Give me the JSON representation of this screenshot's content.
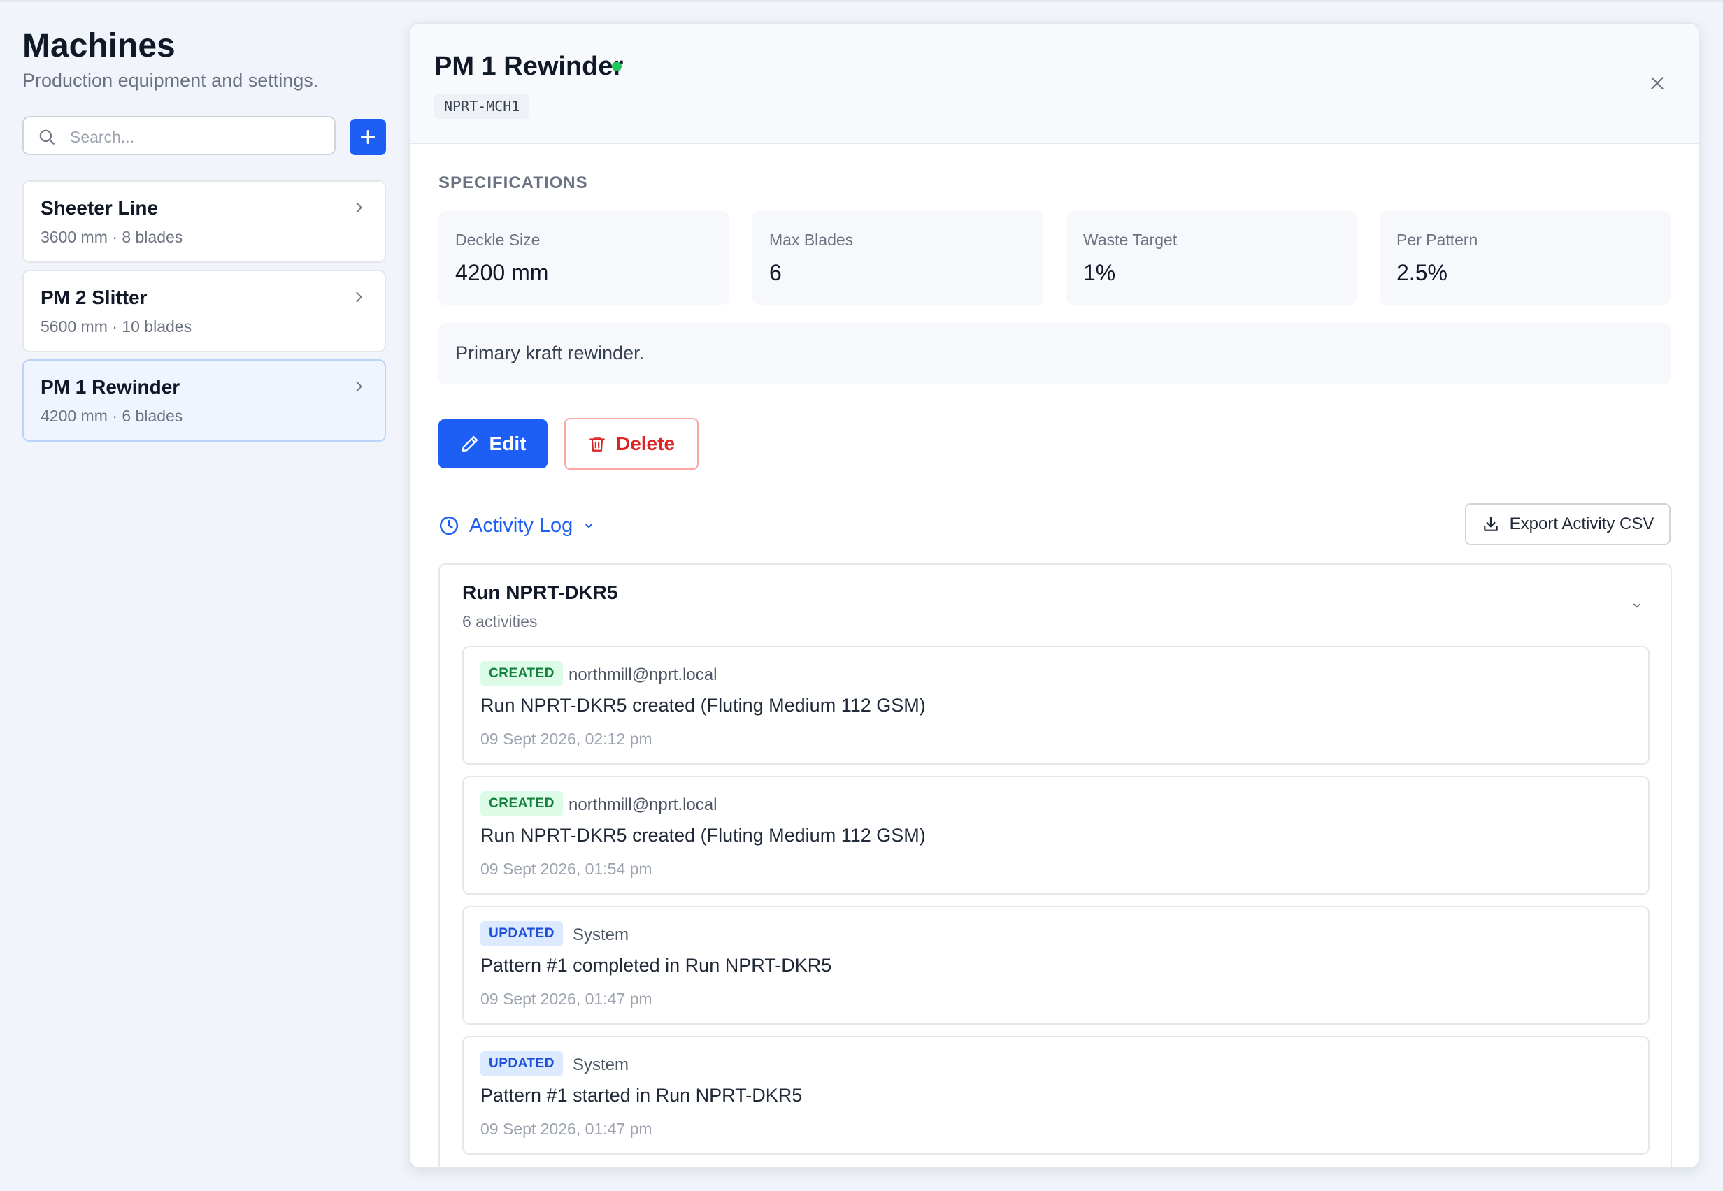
{
  "sidebar": {
    "title": "Machines",
    "subtitle": "Production equipment and settings.",
    "search_placeholder": "Search...",
    "add_label": "+",
    "machines": [
      {
        "name": "Sheeter Line",
        "meta": "3600 mm · 8 blades",
        "selected": false
      },
      {
        "name": "PM 2 Slitter",
        "meta": "5600 mm · 10 blades",
        "selected": false
      },
      {
        "name": "PM 1 Rewinder",
        "meta": "4200 mm · 6 blades",
        "selected": true
      }
    ]
  },
  "detail": {
    "title": "PM 1 Rewinder",
    "status_color": "#22c55e",
    "code": "NPRT-MCH1",
    "specifications_label": "SPECIFICATIONS",
    "specs": [
      {
        "label": "Deckle Size",
        "value": "4200 mm"
      },
      {
        "label": "Max Blades",
        "value": "6"
      },
      {
        "label": "Waste Target",
        "value": "1%"
      },
      {
        "label": "Per Pattern",
        "value": "2.5%"
      }
    ],
    "description": "Primary kraft rewinder.",
    "edit_label": "Edit",
    "delete_label": "Delete",
    "activity_log_label": "Activity Log",
    "export_label": "Export Activity CSV"
  },
  "activity": {
    "run_title": "Run NPRT-DKR5",
    "run_count": "6 activities",
    "items": [
      {
        "type": "CREATED",
        "user": "northmill@nprt.local",
        "message": "Run NPRT-DKR5 created (Fluting Medium 112 GSM)",
        "time": "09 Sept 2026, 02:12 pm"
      },
      {
        "type": "CREATED",
        "user": "northmill@nprt.local",
        "message": "Run NPRT-DKR5 created (Fluting Medium 112 GSM)",
        "time": "09 Sept 2026, 01:54 pm"
      },
      {
        "type": "UPDATED",
        "user": "System",
        "message": "Pattern #1 completed in Run NPRT-DKR5",
        "time": "09 Sept 2026, 01:47 pm"
      },
      {
        "type": "UPDATED",
        "user": "System",
        "message": "Pattern #1 started in Run NPRT-DKR5",
        "time": "09 Sept 2026, 01:47 pm"
      }
    ]
  },
  "colors": {
    "accent": "#1d5ff5",
    "danger": "#dc2626",
    "created_badge": "#15803d",
    "updated_badge": "#1d4ed8"
  }
}
